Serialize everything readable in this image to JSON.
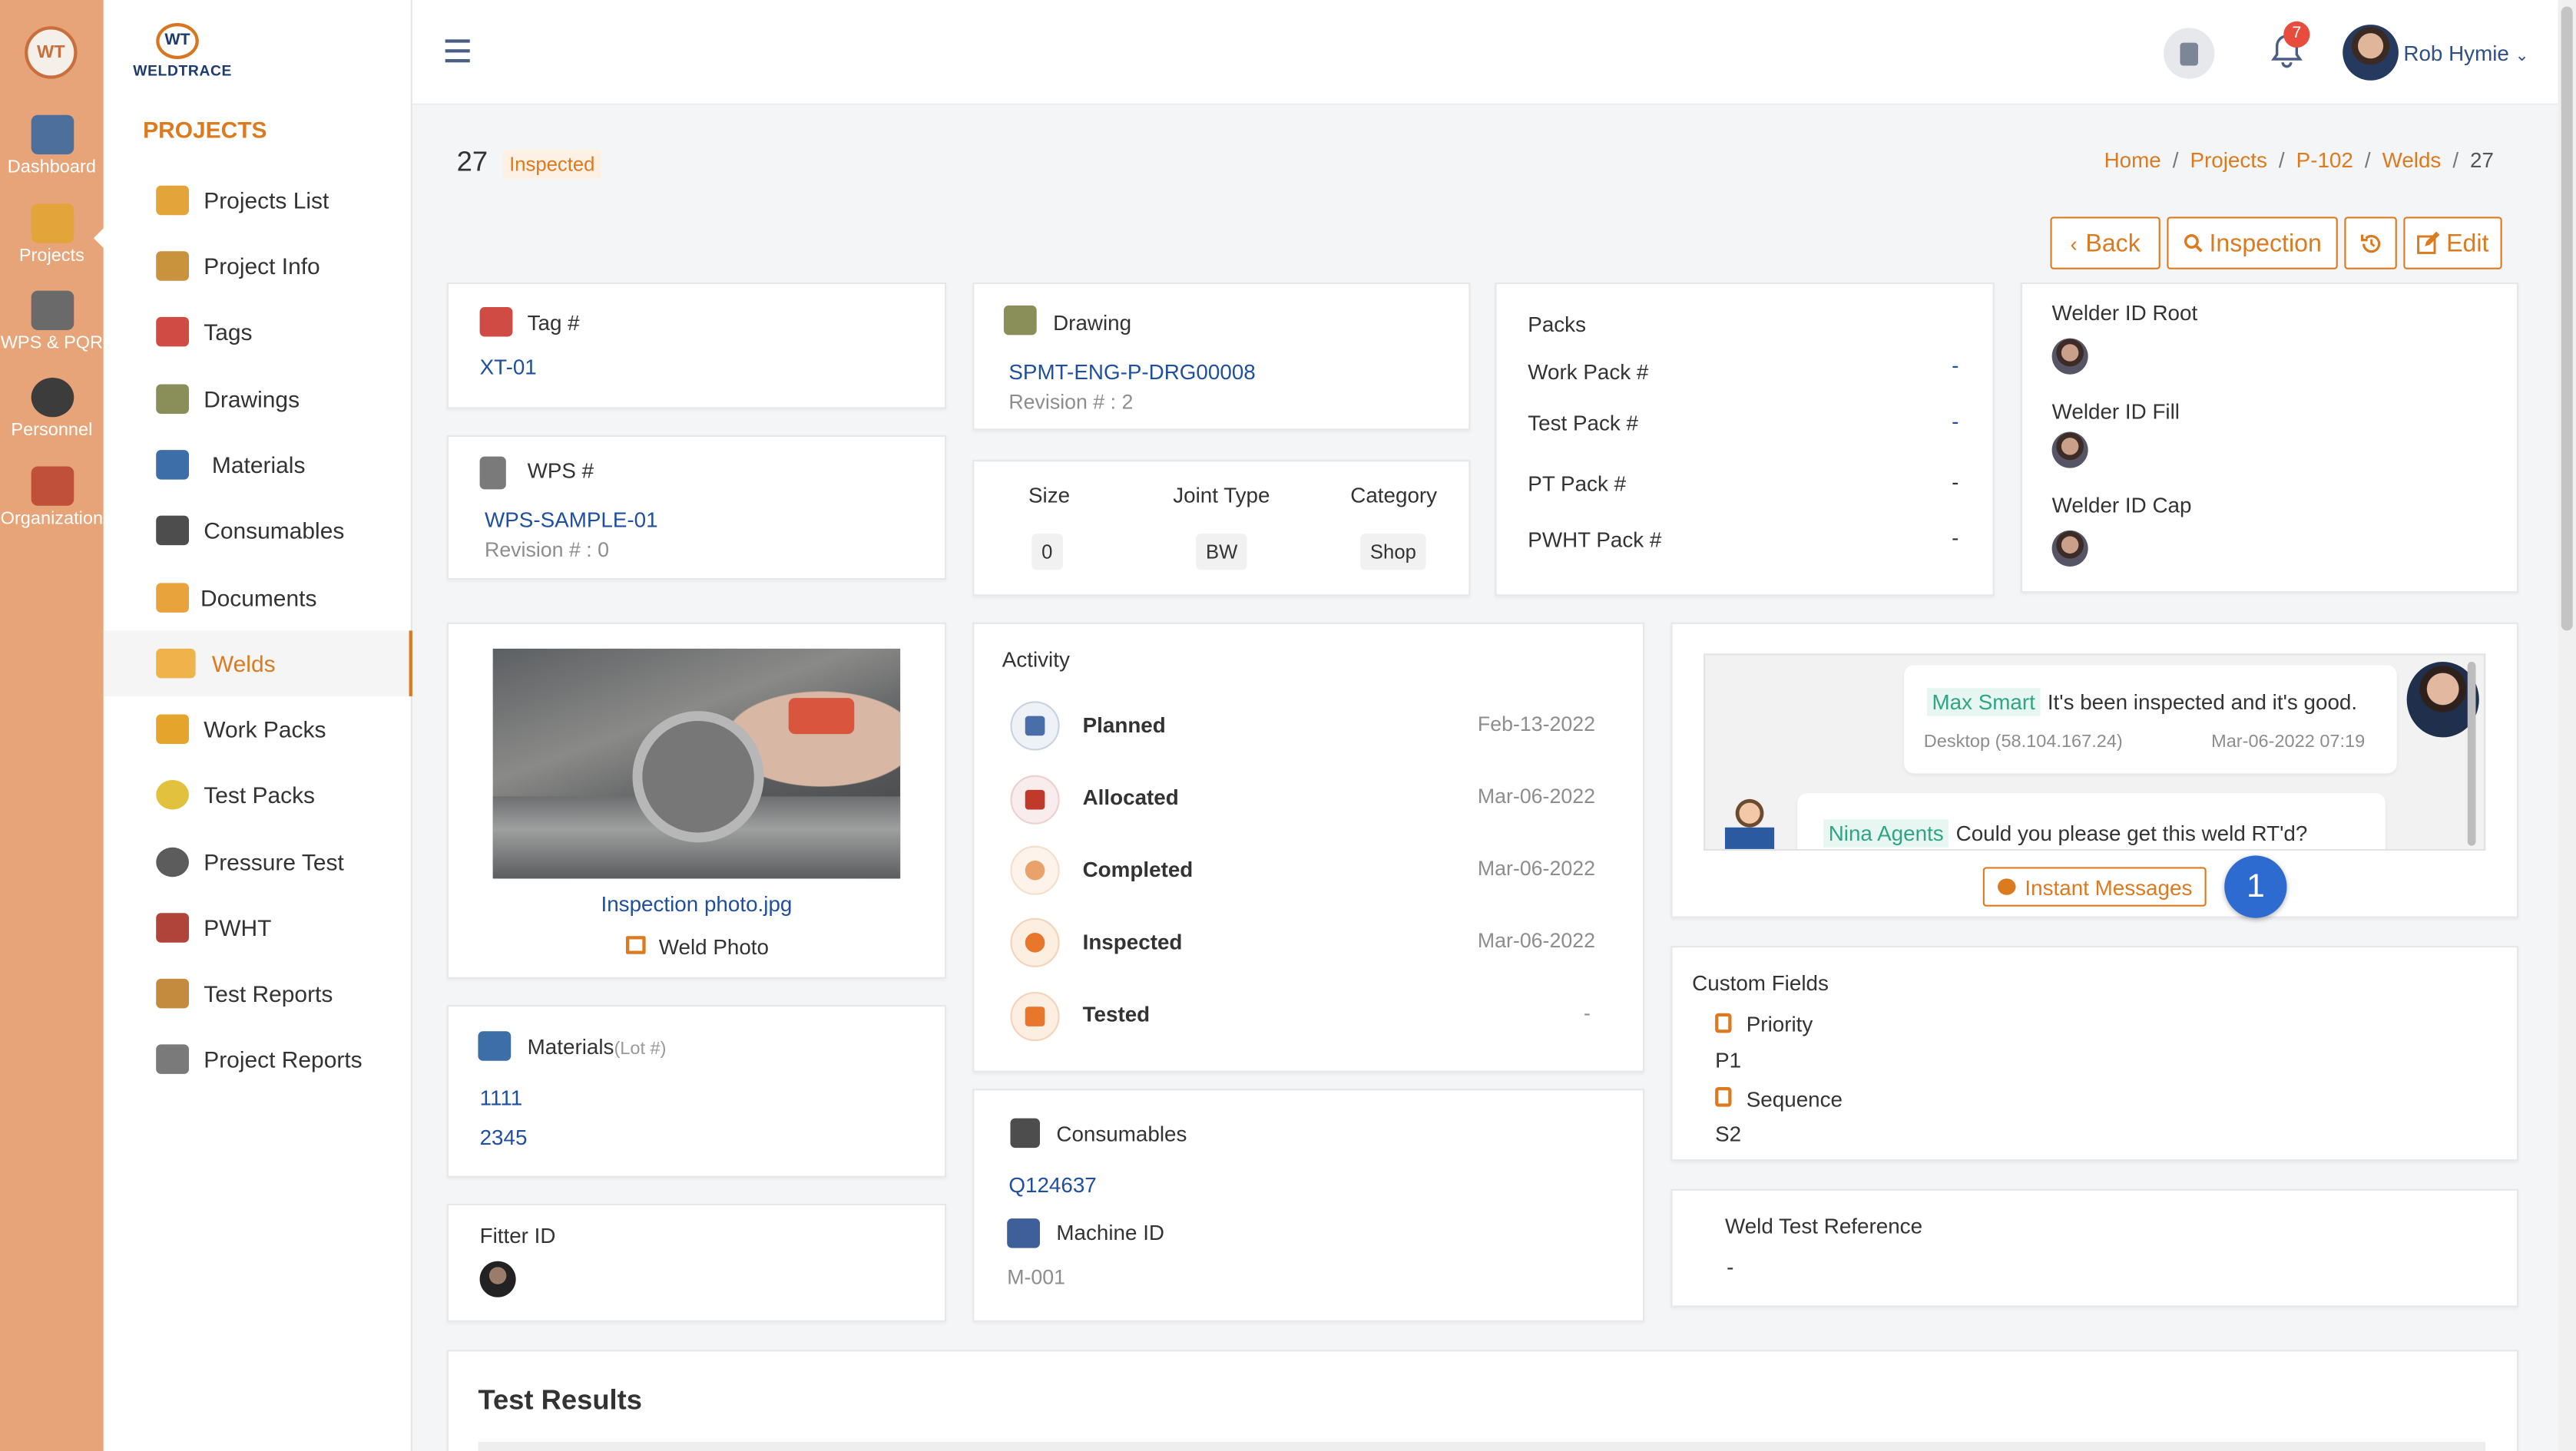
{
  "rail": {
    "items": [
      {
        "label": "Dashboard"
      },
      {
        "label": "Projects"
      },
      {
        "label": "WPS & PQR"
      },
      {
        "label": "Personnel"
      },
      {
        "label": "Organization"
      }
    ]
  },
  "brand": {
    "name": "WELDTRACE",
    "mark": "WT"
  },
  "menu": {
    "heading": "PROJECTS",
    "items": [
      {
        "label": "Projects List"
      },
      {
        "label": "Project Info"
      },
      {
        "label": "Tags"
      },
      {
        "label": "Drawings"
      },
      {
        "label": "Materials"
      },
      {
        "label": "Consumables"
      },
      {
        "label": "Documents"
      },
      {
        "label": "Welds"
      },
      {
        "label": "Work Packs"
      },
      {
        "label": "Test Packs"
      },
      {
        "label": "Pressure Test"
      },
      {
        "label": "PWHT"
      },
      {
        "label": "Test Reports"
      },
      {
        "label": "Project Reports"
      }
    ],
    "active": "Welds"
  },
  "topbar": {
    "notifications": "7",
    "user": "Rob Hymie",
    "user_caret": "⌄"
  },
  "page": {
    "id": "27",
    "status": "Inspected"
  },
  "breadcrumb": [
    "Home",
    "Projects",
    "P-102",
    "Welds",
    "27"
  ],
  "breadcrumb_sep": "/",
  "actions": {
    "back": "Back",
    "inspection": "Inspection",
    "edit": "Edit"
  },
  "tag": {
    "label": "Tag #",
    "value": "XT-01"
  },
  "wps": {
    "label": "WPS #",
    "value": "WPS-SAMPLE-01",
    "revision": "Revision # : 0"
  },
  "drawing": {
    "label": "Drawing",
    "value": "SPMT-ENG-P-DRG00008",
    "revision": "Revision # : 2"
  },
  "joint": {
    "size_label": "Size",
    "size": "0",
    "type_label": "Joint Type",
    "type": "BW",
    "category_label": "Category",
    "category": "Shop"
  },
  "packs": {
    "title": "Packs",
    "rows": [
      {
        "label": "Work Pack #",
        "value": "-"
      },
      {
        "label": "Test Pack #",
        "value": "-"
      },
      {
        "label": "PT Pack #",
        "value": "-"
      },
      {
        "label": "PWHT Pack #",
        "value": "-"
      }
    ]
  },
  "welders": {
    "root": "Welder ID Root",
    "fill": "Welder ID Fill",
    "cap": "Welder ID Cap"
  },
  "photo": {
    "filename": "Inspection photo.jpg",
    "caption": "Weld Photo"
  },
  "activity": {
    "title": "Activity",
    "rows": [
      {
        "label": "Planned",
        "date": "Feb-13-2022",
        "color": "#4a6fa8"
      },
      {
        "label": "Allocated",
        "date": "Mar-06-2022",
        "color": "#c0392b"
      },
      {
        "label": "Completed",
        "date": "Mar-06-2022",
        "color": "#e9a36a"
      },
      {
        "label": "Inspected",
        "date": "Mar-06-2022",
        "color": "#e8762b"
      },
      {
        "label": "Tested",
        "date": "-",
        "color": "#e8762b"
      }
    ]
  },
  "chat": {
    "messages": [
      {
        "name": "Max Smart",
        "text": "It's been inspected and it's good.",
        "device": "Desktop (58.104.167.24)",
        "time": "Mar-06-2022 07:19"
      },
      {
        "name": "Nina Agents",
        "text": "Could you please get this weld RT'd?"
      }
    ],
    "button": "Instant Messages",
    "badge": "1"
  },
  "materials": {
    "label": "Materials",
    "sub": "(Lot #)",
    "items": [
      "1111",
      "2345"
    ]
  },
  "fitter": {
    "label": "Fitter ID"
  },
  "consumables": {
    "label": "Consumables",
    "value": "Q124637",
    "machine_label": "Machine ID",
    "machine": "M-001"
  },
  "custom": {
    "title": "Custom Fields",
    "priority_label": "Priority",
    "priority": "P1",
    "sequence_label": "Sequence",
    "sequence": "S2"
  },
  "weld_test": {
    "label": "Weld Test Reference",
    "value": "-"
  },
  "test_results": {
    "title": "Test Results"
  },
  "colors": {
    "accent": "#dc7a1f",
    "rail": "#e8a479",
    "link": "#1f4f9e",
    "badge": "#2e6bd0"
  }
}
